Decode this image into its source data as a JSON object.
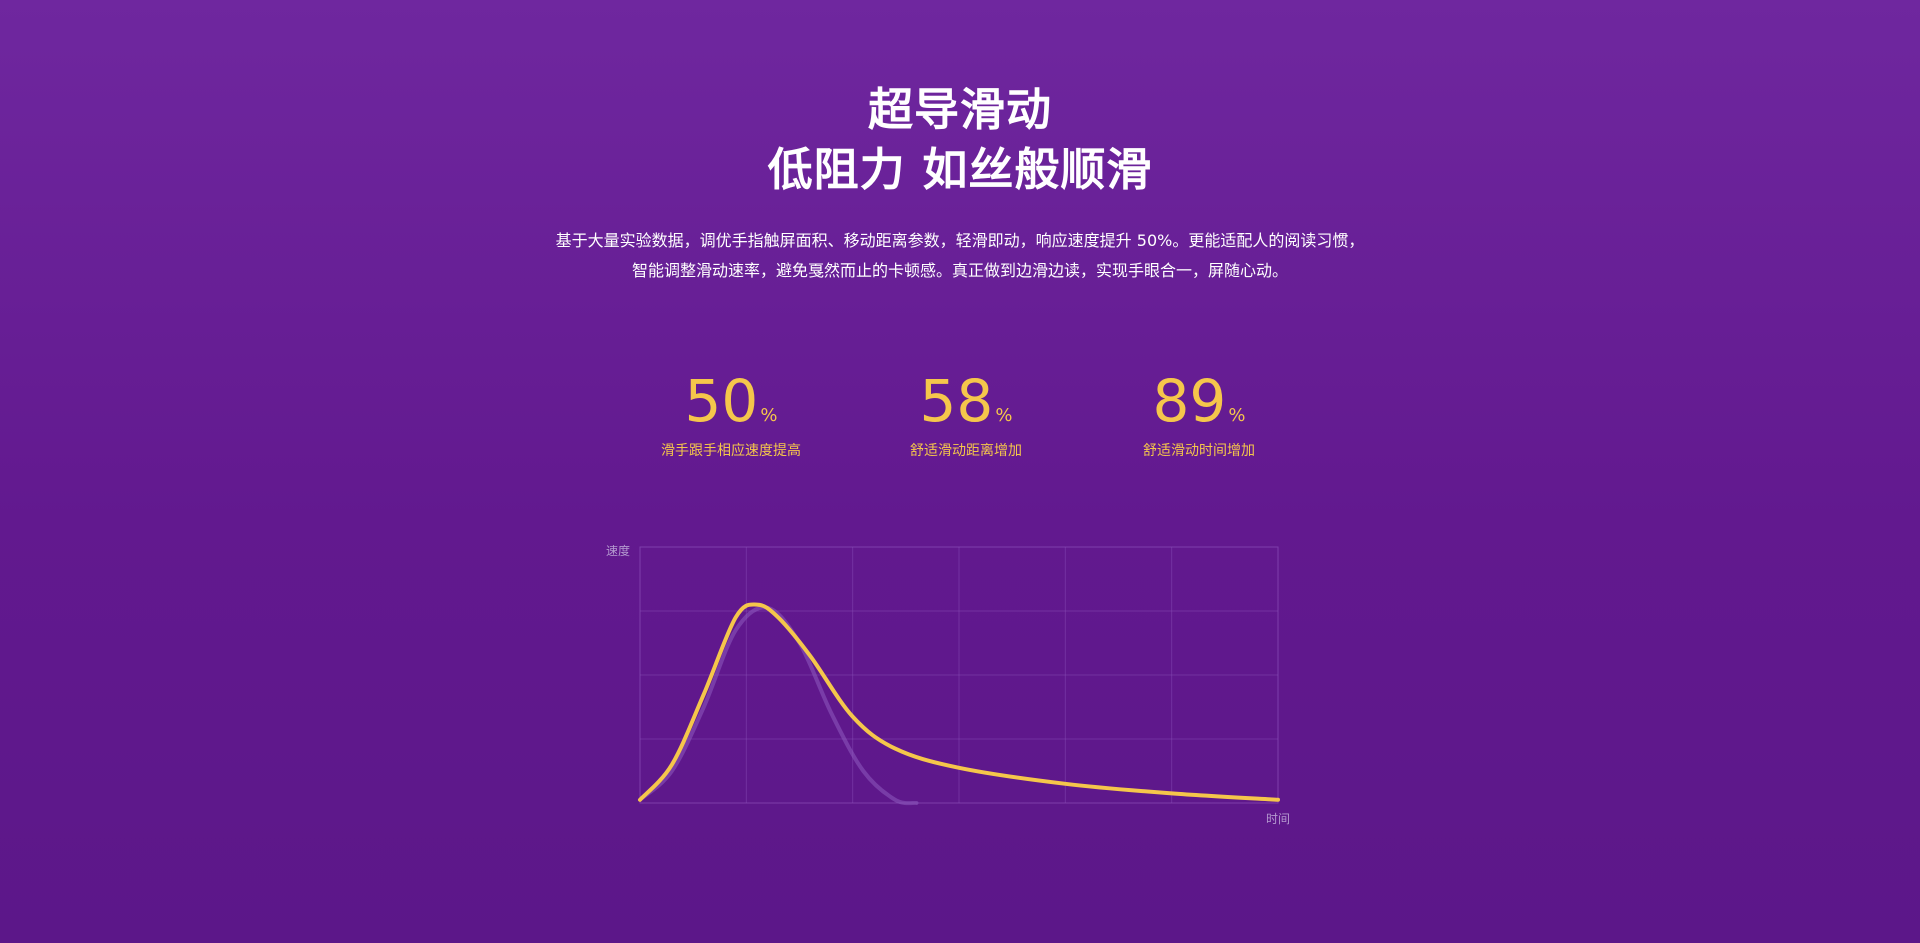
{
  "headline": {
    "line1": "超导滑动",
    "line2": "低阻力 如丝般顺滑"
  },
  "description": {
    "line1": "基于大量实验数据，调优手指触屏面积、移动距离参数，轻滑即动，响应速度提升 50%。更能适配人的阅读习惯，",
    "line2": "智能调整滑动速率，避免戛然而止的卡顿感。真正做到边滑边读，实现手眼合一，屏随心动。"
  },
  "stats": [
    {
      "value": "50",
      "unit": "%",
      "label": "滑手跟手相应速度提高"
    },
    {
      "value": "58",
      "unit": "%",
      "label": "舒适滑动距离增加"
    },
    {
      "value": "89",
      "unit": "%",
      "label": "舒适滑动时间增加"
    }
  ],
  "colors": {
    "accent": "#f5c64b",
    "background_top": "#6f279f",
    "background_bottom": "#5c1789",
    "grid": "#8a4fb8",
    "old_curve": "#8e5bbf"
  },
  "chart_data": {
    "type": "line",
    "xlabel": "时间",
    "ylabel": "速度",
    "grid": true,
    "xlim": [
      0,
      6
    ],
    "ylim": [
      0,
      4
    ],
    "series": [
      {
        "x": [
          0,
          0.3,
          0.6,
          0.9,
          1.1,
          1.3,
          1.6,
          2.0,
          2.4,
          3.0,
          4.0,
          5.0,
          6.0
        ],
        "y": [
          0.05,
          0.6,
          1.7,
          2.9,
          3.1,
          2.9,
          2.3,
          1.35,
          0.85,
          0.55,
          0.3,
          0.15,
          0.05
        ]
      },
      {
        "x": [
          0,
          0.3,
          0.6,
          0.9,
          1.2,
          1.5,
          1.8,
          2.1,
          2.4,
          2.6
        ],
        "y": [
          0.05,
          0.5,
          1.5,
          2.7,
          3.05,
          2.5,
          1.4,
          0.5,
          0.05,
          0.0
        ]
      }
    ]
  }
}
